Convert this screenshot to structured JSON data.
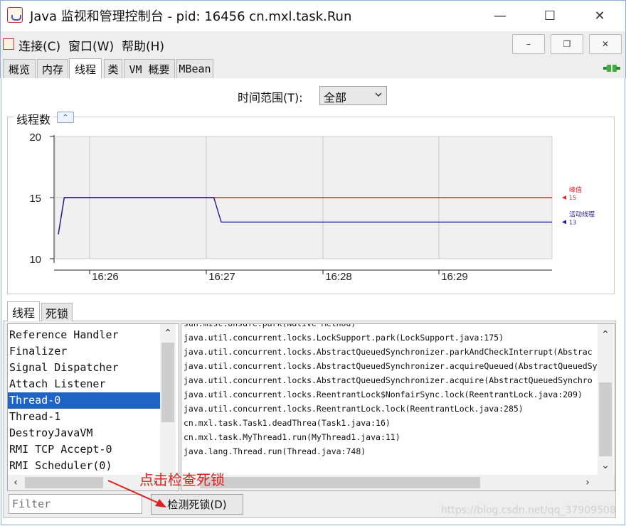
{
  "window": {
    "title": "Java 监视和管理控制台 - pid: 16456 cn.mxl.task.Run",
    "controls": [
      "—",
      "☐",
      "✕"
    ]
  },
  "menu": {
    "items": [
      {
        "label": "连接(C)"
      },
      {
        "label": "窗口(W)"
      },
      {
        "label": "帮助(H)"
      }
    ],
    "mdi_controls": [
      "–",
      "❐",
      "✕"
    ]
  },
  "tabs": [
    {
      "label": "概览",
      "active": false
    },
    {
      "label": "内存",
      "active": false
    },
    {
      "label": "线程",
      "active": true
    },
    {
      "label": "类",
      "active": false
    },
    {
      "label": "VM 概要",
      "active": false
    },
    {
      "label": "MBean",
      "active": false
    }
  ],
  "time_range": {
    "label": "时间范围(T):",
    "value": "全部"
  },
  "chart_panel": {
    "title": "线程数",
    "collapse_icon": "chevron-up-icon"
  },
  "chart_data": {
    "type": "line",
    "ylim": [
      10,
      20
    ],
    "yticks": [
      "20",
      "15",
      "10"
    ],
    "xticks": [
      "16:26",
      "16:27",
      "16:28",
      "16:29"
    ],
    "series": [
      {
        "name": "峰值",
        "color": "#e0262f",
        "current": "15",
        "points": [
          [
            0,
            12
          ],
          [
            0.012,
            15
          ],
          [
            1,
            15
          ]
        ]
      },
      {
        "name": "活动线程",
        "color": "#1f1f9a",
        "current": "13",
        "points": [
          [
            0,
            12
          ],
          [
            0.012,
            15
          ],
          [
            0.315,
            15
          ],
          [
            0.33,
            13
          ],
          [
            1,
            13
          ]
        ]
      }
    ],
    "grid": true
  },
  "subtabs": [
    {
      "label": "线程",
      "active": true
    },
    {
      "label": "死锁",
      "active": false
    }
  ],
  "thread_list": {
    "items": [
      {
        "label": "Reference Handler",
        "selected": false
      },
      {
        "label": "Finalizer",
        "selected": false
      },
      {
        "label": "Signal Dispatcher",
        "selected": false
      },
      {
        "label": "Attach Listener",
        "selected": false
      },
      {
        "label": "Thread-0",
        "selected": true
      },
      {
        "label": "Thread-1",
        "selected": false
      },
      {
        "label": "DestroyJavaVM",
        "selected": false
      },
      {
        "label": "RMI TCP Accept-0",
        "selected": false
      },
      {
        "label": "RMI Scheduler(0)",
        "selected": false
      }
    ]
  },
  "stack_trace": {
    "lines": [
      "sun.misc.Unsafe.park(Native Method)",
      "java.util.concurrent.locks.LockSupport.park(LockSupport.java:175)",
      "java.util.concurrent.locks.AbstractQueuedSynchronizer.parkAndCheckInterrupt(Abstrac",
      "java.util.concurrent.locks.AbstractQueuedSynchronizer.acquireQueued(AbstractQueuedSy",
      "java.util.concurrent.locks.AbstractQueuedSynchronizer.acquire(AbstractQueuedSynchro",
      "java.util.concurrent.locks.ReentrantLock$NonfairSync.lock(ReentrantLock.java:209)",
      "java.util.concurrent.locks.ReentrantLock.lock(ReentrantLock.java:285)",
      "cn.mxl.task.Task1.deadThrea(Task1.java:16)",
      "cn.mxl.task.MyThread1.run(MyThread1.java:11)",
      "java.lang.Thread.run(Thread.java:748)"
    ]
  },
  "filter": {
    "placeholder": "Filter"
  },
  "detect_button": {
    "label": "检测死锁(D)"
  },
  "annotation": {
    "text": "点击检查死锁"
  },
  "watermark": {
    "text": "https://blog.csdn.net/qq_37909508"
  },
  "colors": {
    "selection": "#1f63c4",
    "peak_line": "#e0262f",
    "live_line": "#1f1f9a",
    "annotation": "#e11d1d"
  }
}
